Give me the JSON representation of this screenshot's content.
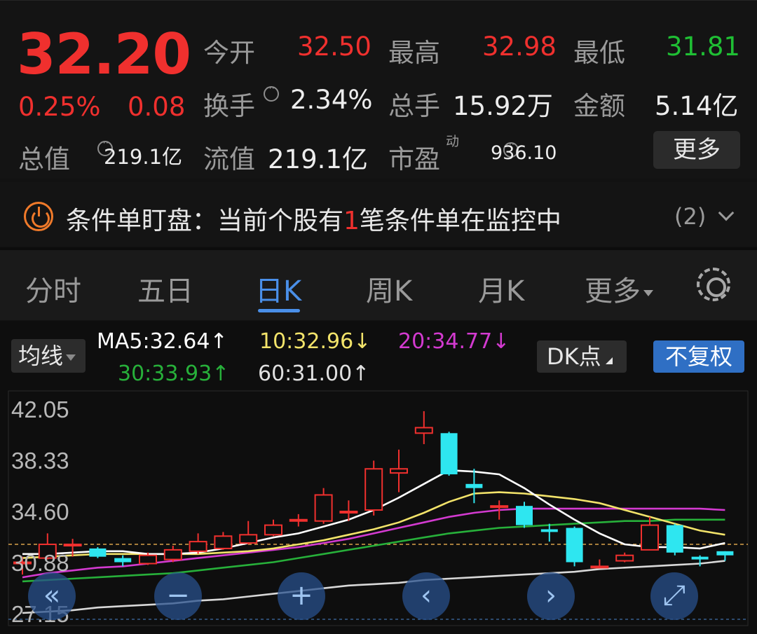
{
  "quote": {
    "price": "32.20",
    "change_pct": "0.25%",
    "change_abs": "0.08",
    "open_label": "今开",
    "open_value": "32.50",
    "high_label": "最高",
    "high_value": "32.98",
    "low_label": "最低",
    "low_value": "31.81",
    "turnover_label": "换手",
    "turnover_value": "2.34%",
    "volume_label": "总手",
    "volume_value": "15.92万",
    "amount_label": "金额",
    "amount_value": "5.14亿",
    "mktcap_label": "总值",
    "mktcap_value": "219.1亿",
    "float_label": "流值",
    "float_value": "219.1亿",
    "pe_label": "市盈",
    "pe_superscript": "动",
    "pe_value": "936.10",
    "more_button": "更多",
    "colors": {
      "up": "#f0302e",
      "down": "#1fbf34"
    }
  },
  "alert": {
    "prefix": "条件单盯盘：当前个股有",
    "count": "1",
    "suffix": "笔条件单在监控中",
    "badge": "(2)"
  },
  "tabs": [
    {
      "label": "分时",
      "active": false
    },
    {
      "label": "五日",
      "active": false
    },
    {
      "label": "日K",
      "active": true
    },
    {
      "label": "周K",
      "active": false
    },
    {
      "label": "月K",
      "active": false
    },
    {
      "label": "更多",
      "active": false
    }
  ],
  "chart_controls": {
    "ma_button": "均线",
    "ma5": "MA5:32.64↑",
    "ma10": "10:32.96↓",
    "ma20": "20:34.77↓",
    "ma30": "30:33.93↑",
    "ma60": "60:31.00↑",
    "dk_button": "DK点",
    "fq_button": "不复权",
    "colors": {
      "ma5": "#ffffff",
      "ma10": "#f2e36a",
      "ma20": "#d33ad0",
      "ma30": "#27b03a",
      "ma60": "#d8d8d8",
      "bull": "#f0302e",
      "bear": "#2ee6f0"
    }
  },
  "chart_data": {
    "type": "candlestick",
    "y_ticks": [
      "42.05",
      "38.33",
      "34.60",
      "30.88",
      "27.15"
    ],
    "ylim": [
      27.15,
      42.05
    ],
    "candles": [
      {
        "o": 30.9,
        "c": 30.9,
        "h": 31.3,
        "l": 30.0
      },
      {
        "o": 31.2,
        "c": 32.2,
        "h": 33.0,
        "l": 31.1
      },
      {
        "o": 32.1,
        "c": 32.2,
        "h": 32.6,
        "l": 31.3
      },
      {
        "o": 31.9,
        "c": 31.3,
        "h": 32.0,
        "l": 31.2
      },
      {
        "o": 31.2,
        "c": 30.9,
        "h": 31.4,
        "l": 30.6
      },
      {
        "o": 30.8,
        "c": 31.4,
        "h": 31.6,
        "l": 30.7
      },
      {
        "o": 31.1,
        "c": 31.8,
        "h": 32.1,
        "l": 30.9
      },
      {
        "o": 31.7,
        "c": 32.4,
        "h": 33.0,
        "l": 31.5
      },
      {
        "o": 31.9,
        "c": 32.8,
        "h": 33.1,
        "l": 31.8
      },
      {
        "o": 32.3,
        "c": 32.9,
        "h": 33.9,
        "l": 32.2
      },
      {
        "o": 32.9,
        "c": 33.6,
        "h": 34.0,
        "l": 32.8
      },
      {
        "o": 33.9,
        "c": 34.0,
        "h": 34.4,
        "l": 33.5
      },
      {
        "o": 33.9,
        "c": 35.8,
        "h": 36.3,
        "l": 33.7
      },
      {
        "o": 34.6,
        "c": 34.6,
        "h": 35.4,
        "l": 33.9
      },
      {
        "o": 34.7,
        "c": 37.7,
        "h": 38.3,
        "l": 34.3
      },
      {
        "o": 37.4,
        "c": 37.7,
        "h": 39.1,
        "l": 36.0
      },
      {
        "o": 40.3,
        "c": 40.7,
        "h": 41.9,
        "l": 39.5
      },
      {
        "o": 40.3,
        "c": 37.3,
        "h": 40.4,
        "l": 37.2
      },
      {
        "o": 36.6,
        "c": 36.3,
        "h": 37.7,
        "l": 35.2
      },
      {
        "o": 35.0,
        "c": 35.0,
        "h": 35.4,
        "l": 34.0
      },
      {
        "o": 35.0,
        "c": 33.6,
        "h": 35.3,
        "l": 33.4
      },
      {
        "o": 33.3,
        "c": 33.1,
        "h": 33.7,
        "l": 32.4
      },
      {
        "o": 33.4,
        "c": 30.9,
        "h": 33.5,
        "l": 30.6
      },
      {
        "o": 30.6,
        "c": 30.6,
        "h": 31.1,
        "l": 30.5
      },
      {
        "o": 31.0,
        "c": 31.4,
        "h": 31.6,
        "l": 30.9
      },
      {
        "o": 31.8,
        "c": 33.6,
        "h": 34.2,
        "l": 31.8
      },
      {
        "o": 33.6,
        "c": 31.6,
        "h": 33.7,
        "l": 31.4
      },
      {
        "o": 31.3,
        "c": 31.1,
        "h": 31.4,
        "l": 30.6
      },
      {
        "o": 31.7,
        "c": 31.4,
        "h": 31.7,
        "l": 31.0
      }
    ],
    "ma5": [
      31.5,
      31.5,
      31.6,
      31.7,
      31.7,
      31.5,
      31.5,
      31.6,
      31.9,
      32.3,
      32.7,
      33.0,
      33.5,
      34.0,
      34.7,
      35.6,
      36.6,
      37.6,
      37.5,
      37.3,
      36.3,
      35.1,
      34.0,
      33.0,
      32.2,
      32.0,
      32.0,
      31.9,
      32.3
    ],
    "ma10": [
      31.2,
      31.3,
      31.4,
      31.5,
      31.5,
      31.5,
      31.5,
      31.5,
      31.6,
      31.7,
      31.9,
      32.2,
      32.5,
      32.9,
      33.3,
      33.8,
      34.5,
      35.3,
      35.9,
      36.0,
      35.9,
      35.7,
      35.5,
      35.2,
      34.7,
      34.2,
      33.7,
      33.2,
      32.9
    ],
    "ma20": [
      29.8,
      30.1,
      30.3,
      30.5,
      30.6,
      30.8,
      31.0,
      31.2,
      31.4,
      31.6,
      31.8,
      32.0,
      32.3,
      32.6,
      33.0,
      33.4,
      33.8,
      34.2,
      34.5,
      34.7,
      34.8,
      34.8,
      34.8,
      34.8,
      34.8,
      34.8,
      34.8,
      34.8,
      34.7
    ],
    "ma30": [
      29.5,
      29.6,
      29.7,
      29.8,
      29.9,
      30.0,
      30.1,
      30.3,
      30.5,
      30.7,
      30.9,
      31.2,
      31.5,
      31.8,
      32.1,
      32.4,
      32.7,
      33.0,
      33.2,
      33.4,
      33.5,
      33.6,
      33.7,
      33.8,
      33.9,
      33.9,
      34.0,
      34.0,
      34.0
    ],
    "ma60": [
      27.2,
      27.3,
      27.4,
      27.6,
      27.7,
      27.8,
      27.9,
      28.1,
      28.2,
      28.4,
      28.6,
      28.8,
      29.0,
      29.2,
      29.3,
      29.4,
      29.6,
      29.7,
      29.8,
      29.9,
      30.0,
      30.1,
      30.2,
      30.4,
      30.5,
      30.6,
      30.7,
      30.8,
      31.0
    ],
    "last_price": 32.2
  },
  "controls": [
    {
      "name": "scroll-left-fast-icon",
      "glyph": "«"
    },
    {
      "name": "zoom-out-icon",
      "glyph": "−"
    },
    {
      "name": "zoom-in-icon",
      "glyph": "+"
    },
    {
      "name": "scroll-left-icon",
      "glyph": "‹"
    },
    {
      "name": "scroll-right-icon",
      "glyph": "›"
    },
    {
      "name": "fullscreen-icon",
      "glyph": "⤢"
    }
  ]
}
